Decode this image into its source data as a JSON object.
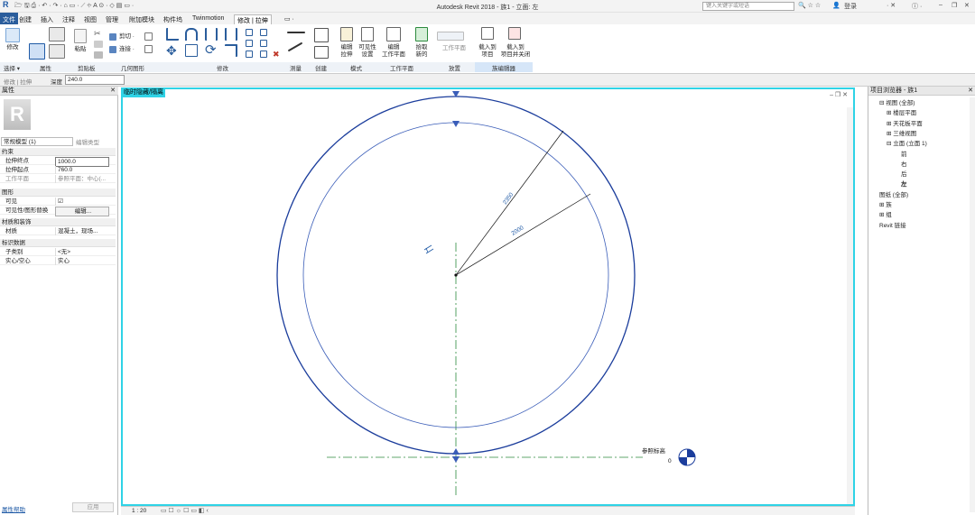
{
  "titlebar": {
    "app_title": "Autodesk Revit 2018 -   族1 - 立面: 左",
    "search_placeholder": "键入关键字或短语",
    "login": "登录"
  },
  "ribbon_tabs": [
    "文件",
    "创建",
    "插入",
    "注释",
    "视图",
    "管理",
    "附加模块",
    "构件坞",
    "Twinmotion",
    "修改 | 拉伸"
  ],
  "ribbon": {
    "modify": "修改",
    "select_label": "选择 ▾",
    "properties_panel": "属性",
    "clipboard_panel": "剪贴板",
    "paste": "粘贴",
    "cut": "剪切 ·",
    "join": "连接 ·",
    "geometry_panel": "几何图形",
    "modify_panel": "修改",
    "measure_panel": "测量",
    "create_panel": "创建",
    "edit_extrusion": "编辑\n拉伸",
    "visibility": "可见性\n设置",
    "edit_workplane": "编辑\n工作平面",
    "pick_new": "拾取\n新的",
    "workplane_btn": "工作平面",
    "load_project": "载入到\n项目",
    "load_close": "载入到\n项目并关闭",
    "mode_panel": "模式",
    "workplane_panel": "工作平面",
    "place_panel": "放置",
    "family_editor_panel": "族编辑器"
  },
  "optbar": {
    "crumbs": "修改 | 拉伸",
    "depth_label": "深度",
    "depth_value": "240.0"
  },
  "properties": {
    "title": "属性",
    "type_selector": "常规模型 (1)",
    "edit_type": "编辑类型",
    "sections": [
      {
        "name": "约束",
        "rows": [
          {
            "k": "拉伸终点",
            "v": "1000.0"
          },
          {
            "k": "拉伸起点",
            "v": "760.0"
          },
          {
            "k": "工作平面",
            "v": "参照平面：中心(..."
          }
        ]
      },
      {
        "name": "图形",
        "rows": [
          {
            "k": "可见",
            "v": "☑"
          },
          {
            "k": "可见性/图形替换",
            "v": "编辑..."
          }
        ]
      },
      {
        "name": "材质和装饰",
        "rows": [
          {
            "k": "材质",
            "v": "混凝土，现场..."
          }
        ]
      },
      {
        "name": "标识数据",
        "rows": [
          {
            "k": "子类别",
            "v": "<无>"
          },
          {
            "k": "实心/空心",
            "v": "实心"
          }
        ]
      }
    ],
    "help_link": "属性帮助",
    "apply": "应用"
  },
  "view": {
    "label": "临时隐藏/隔离",
    "dim_outer": "2350",
    "dim_inner": "2000",
    "level_name": "参照标高",
    "level_value": "0"
  },
  "statusbar": {
    "scale": "1 : 20"
  },
  "browser": {
    "title": "项目浏览器 - 族1",
    "items": [
      {
        "t": "⊟ 视图 (全部)",
        "lvl": 0
      },
      {
        "t": "⊞ 楼层平面",
        "lvl": 1
      },
      {
        "t": "⊞ 天花板平面",
        "lvl": 1
      },
      {
        "t": "⊞ 三维视图",
        "lvl": 1
      },
      {
        "t": "⊟ 立面 (立面 1)",
        "lvl": 1
      },
      {
        "t": "前",
        "lvl": 2
      },
      {
        "t": "右",
        "lvl": 2
      },
      {
        "t": "后",
        "lvl": 2
      },
      {
        "t": "左",
        "lvl": 2
      },
      {
        "t": "图纸 (全部)",
        "lvl": 0
      },
      {
        "t": "⊞ 族",
        "lvl": 0
      },
      {
        "t": "⊞ 组",
        "lvl": 0
      },
      {
        "t": "Revit 链接",
        "lvl": 0
      }
    ]
  }
}
